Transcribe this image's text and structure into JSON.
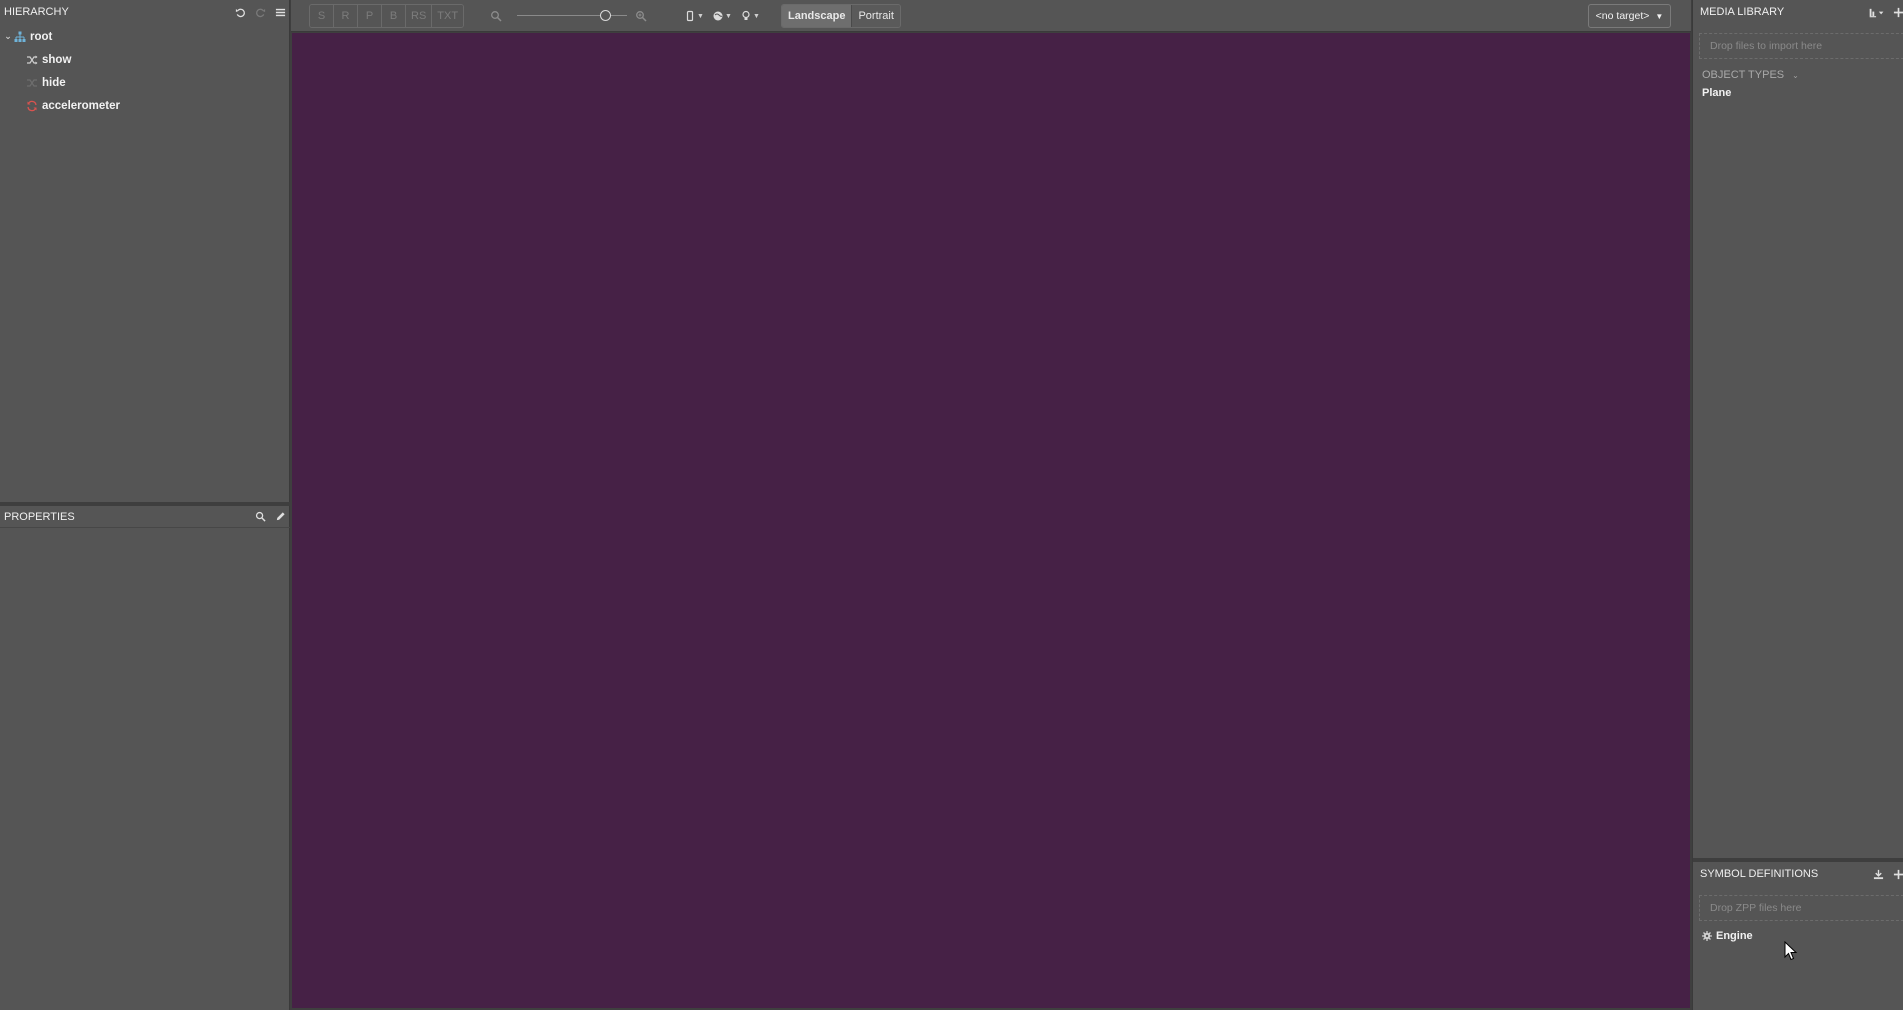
{
  "hierarchy": {
    "title": "HIERARCHY",
    "items": [
      {
        "label": "root",
        "icon": "hierarchy-icon",
        "color": "#6fb3d9"
      },
      {
        "label": "show",
        "icon": "shuffle-icon",
        "color": "#cfcfcf"
      },
      {
        "label": "hide",
        "icon": "hide-icon",
        "color": "#8a8a8a"
      },
      {
        "label": "accelerometer",
        "icon": "refresh-icon",
        "color": "#d9534f"
      }
    ]
  },
  "properties": {
    "title": "PROPERTIES"
  },
  "toolbar": {
    "modes": [
      "S",
      "R",
      "P",
      "B",
      "RS",
      "TXT"
    ],
    "zoom_level": 0.8,
    "orientation": {
      "landscape": "Landscape",
      "portrait": "Portrait",
      "selected": "Landscape"
    },
    "target": "<no target>"
  },
  "viewport": {
    "background": "#462146"
  },
  "media_library": {
    "title": "MEDIA LIBRARY",
    "drop_hint": "Drop files to import here",
    "object_types_label": "OBJECT TYPES",
    "items": [
      "Plane"
    ]
  },
  "symbol_definitions": {
    "title": "SYMBOL DEFINITIONS",
    "drop_hint": "Drop ZPP files here",
    "items": [
      "Engine"
    ]
  }
}
